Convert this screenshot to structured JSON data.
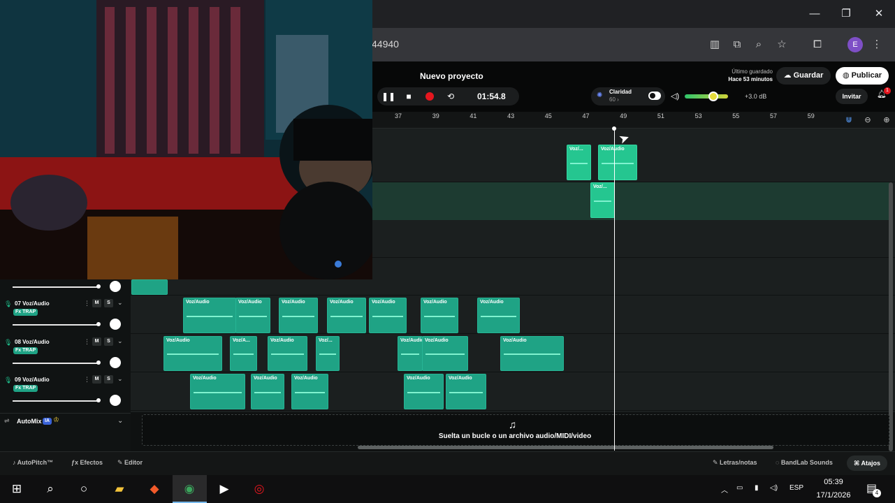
{
  "browser": {
    "url_fragment": "44940"
  },
  "daw": {
    "project_name": "Nuevo proyecto",
    "time": "01:54.8",
    "claridad": {
      "label": "Claridad",
      "value": "60 ›"
    },
    "volume_db": "+3.0 dB",
    "volume_level": 0.66,
    "last_saved_label": "Último guardado",
    "last_saved_time": "Hace 53 minutos",
    "save_label": "Guardar",
    "publish_label": "Publicar",
    "invite_label": "Invitar",
    "notifications_count": "1",
    "ruler_ticks": [
      "37",
      "39",
      "41",
      "43",
      "45",
      "47",
      "49",
      "51",
      "53",
      "55",
      "57",
      "59"
    ],
    "clip_label": "Voz/Audio",
    "clip_label_short": "Voz/...",
    "clip_label_mid": "Voz/A..."
  },
  "tracks": [
    {
      "number": "07",
      "name": "Voz/Audio",
      "fx": "Fx TRAP",
      "mute": "M",
      "solo": "S"
    },
    {
      "number": "08",
      "name": "Voz/Audio",
      "fx": "Fx TRAP",
      "mute": "M",
      "solo": "S"
    },
    {
      "number": "09",
      "name": "Voz/Audio",
      "fx": "Fx TRAP",
      "mute": "M",
      "solo": "S"
    }
  ],
  "automix": {
    "label": "AutoMix",
    "badge": "IA"
  },
  "dropzone": {
    "text": "Suelta un bucle o un archivo audio/MIDI/video"
  },
  "bottombar": {
    "autopitch": "AutoPitch™",
    "effects": "Efectos",
    "editor": "Editor",
    "lyrics": "Letras/notas",
    "sounds": "BandLab Sounds",
    "shortcuts": "Atajos"
  },
  "taskbar": {
    "language": "ESP",
    "time": "05:39",
    "date": "17/1/2026",
    "notifications": "4"
  },
  "colors": {
    "accent": "#1fa385",
    "record": "#e5161e",
    "background": "#1b1f1f"
  }
}
